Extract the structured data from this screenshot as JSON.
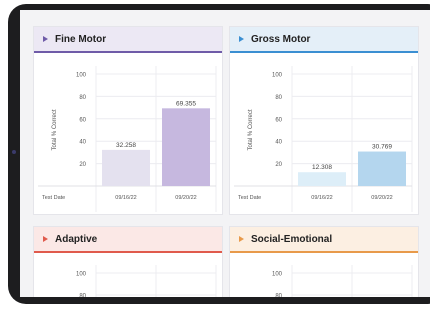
{
  "cards": [
    {
      "title": "Fine Motor",
      "header_bg": "#ece8f4",
      "accent": "#6f5ba8",
      "bar_colors": [
        "#e4e1ef",
        "#c6b8df"
      ],
      "chart_data": {
        "type": "bar",
        "ylabel": "Total % Correct",
        "xlabel": "Test Date",
        "ylim": [
          0,
          100
        ],
        "yticks": [
          20,
          40,
          60,
          80,
          100
        ],
        "categories": [
          "09/16/22",
          "09/20/22"
        ],
        "values": [
          32.258,
          69.355
        ],
        "value_labels": [
          "32.258",
          "69.355"
        ]
      }
    },
    {
      "title": "Gross Motor",
      "header_bg": "#e4eff8",
      "accent": "#3b8fd2",
      "bar_colors": [
        "#ddeef8",
        "#b4d6ee"
      ],
      "chart_data": {
        "type": "bar",
        "ylabel": "Total % Correct",
        "xlabel": "Test Date",
        "ylim": [
          0,
          100
        ],
        "yticks": [
          20,
          40,
          60,
          80,
          100
        ],
        "categories": [
          "09/16/22",
          "09/20/22"
        ],
        "values": [
          12.308,
          30.769
        ],
        "value_labels": [
          "12.308",
          "30.769"
        ]
      }
    },
    {
      "title": "Adaptive",
      "header_bg": "#fbe8e6",
      "accent": "#e05a4c",
      "visible_ticks": [
        "100",
        "80"
      ]
    },
    {
      "title": "Social-Emotional",
      "header_bg": "#fcefe2",
      "accent": "#e89a4a",
      "visible_ticks": [
        "100",
        "80"
      ]
    }
  ]
}
